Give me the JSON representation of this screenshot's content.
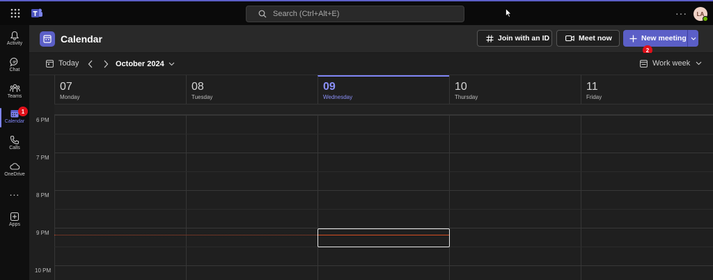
{
  "search": {
    "placeholder": "Search (Ctrl+Alt+E)"
  },
  "user": {
    "initials": "LA"
  },
  "rail": {
    "items": [
      {
        "label": "Activity",
        "icon": "bell-icon"
      },
      {
        "label": "Chat",
        "icon": "chat-icon"
      },
      {
        "label": "Teams",
        "icon": "teams-icon"
      },
      {
        "label": "Calendar",
        "icon": "calendar-icon",
        "active": true
      },
      {
        "label": "Calls",
        "icon": "phone-icon"
      },
      {
        "label": "OneDrive",
        "icon": "cloud-icon"
      },
      {
        "label": "Apps",
        "icon": "add-apps-icon"
      }
    ],
    "more": "..."
  },
  "steps": {
    "one": "1",
    "two": "2"
  },
  "header": {
    "title": "Calendar",
    "join_label": "Join with an ID",
    "meet_label": "Meet now",
    "new_label": "New meeting"
  },
  "toolbar": {
    "today_label": "Today",
    "month_label": "October 2024",
    "view_label": "Work week"
  },
  "days": [
    {
      "num": "07",
      "name": "Monday"
    },
    {
      "num": "08",
      "name": "Tuesday"
    },
    {
      "num": "09",
      "name": "Wednesday",
      "today": true
    },
    {
      "num": "10",
      "name": "Thursday"
    },
    {
      "num": "11",
      "name": "Friday"
    }
  ],
  "times": [
    "6 PM",
    "7 PM",
    "8 PM",
    "9 PM",
    "10 PM"
  ],
  "colors": {
    "accent": "#5b5fc7",
    "today": "#7f85f5",
    "now_line": "#d64e22",
    "badge": "#e0101a"
  }
}
